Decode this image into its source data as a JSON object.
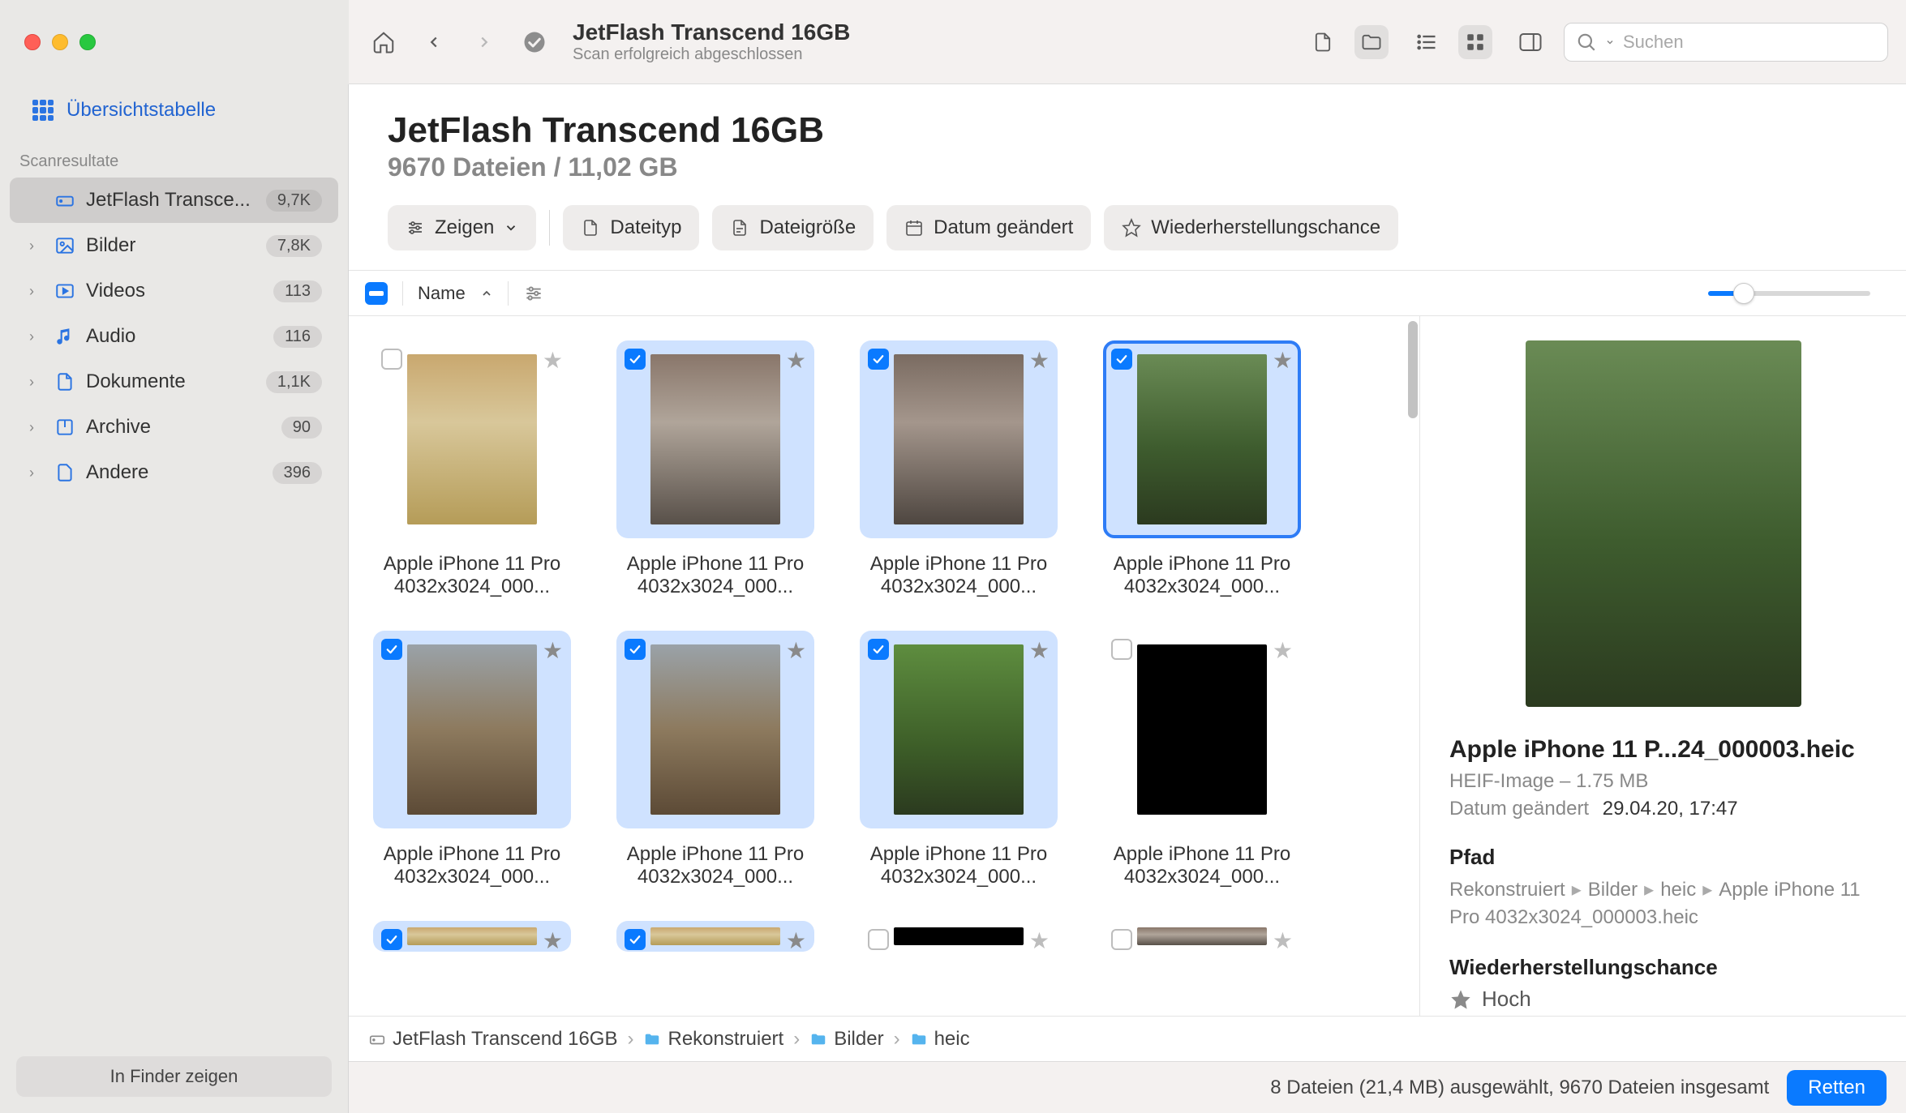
{
  "window": {
    "title": "JetFlash Transcend 16GB",
    "subtitle": "Scan erfolgreich abgeschlossen"
  },
  "search": {
    "placeholder": "Suchen"
  },
  "sidebar": {
    "overview_label": "Übersichtstabelle",
    "section_label": "Scanresultate",
    "items": [
      {
        "label": "JetFlash Transce...",
        "count": "9,7K",
        "icon": "drive",
        "selected": true,
        "expandable": false
      },
      {
        "label": "Bilder",
        "count": "7,8K",
        "icon": "image",
        "expandable": true
      },
      {
        "label": "Videos",
        "count": "113",
        "icon": "video",
        "expandable": true
      },
      {
        "label": "Audio",
        "count": "116",
        "icon": "audio",
        "expandable": true
      },
      {
        "label": "Dokumente",
        "count": "1,1K",
        "icon": "document",
        "expandable": true
      },
      {
        "label": "Archive",
        "count": "90",
        "icon": "archive",
        "expandable": true
      },
      {
        "label": "Andere",
        "count": "396",
        "icon": "other",
        "expandable": true
      }
    ],
    "footer_button": "In Finder zeigen"
  },
  "header": {
    "title": "JetFlash Transcend 16GB",
    "subtitle": "9670 Dateien / 11,02 GB"
  },
  "filters": {
    "show": "Zeigen",
    "filetype": "Dateityp",
    "filesize": "Dateigröße",
    "modified": "Datum geändert",
    "recovery": "Wiederherstellungschance"
  },
  "columns": {
    "name": "Name"
  },
  "tiles": [
    {
      "line1": "Apple iPhone 11 Pro",
      "line2": "4032x3024_000...",
      "checked": false,
      "selected": false,
      "thumb": "th-kitten"
    },
    {
      "line1": "Apple iPhone 11 Pro",
      "line2": "4032x3024_000...",
      "checked": true,
      "selected": true,
      "thumb": "th-cat1"
    },
    {
      "line1": "Apple iPhone 11 Pro",
      "line2": "4032x3024_000...",
      "checked": true,
      "selected": true,
      "thumb": "th-cat2"
    },
    {
      "line1": "Apple iPhone 11 Pro",
      "line2": "4032x3024_000...",
      "checked": true,
      "selected": true,
      "thumb": "th-chick",
      "outline": true
    },
    {
      "line1": "Apple iPhone 11 Pro",
      "line2": "4032x3024_000...",
      "checked": true,
      "selected": true,
      "thumb": "th-dog"
    },
    {
      "line1": "Apple iPhone 11 Pro",
      "line2": "4032x3024_000...",
      "checked": true,
      "selected": true,
      "thumb": "th-dog"
    },
    {
      "line1": "Apple iPhone 11 Pro",
      "line2": "4032x3024_000...",
      "checked": true,
      "selected": true,
      "thumb": "th-ducks"
    },
    {
      "line1": "Apple iPhone 11 Pro",
      "line2": "4032x3024_000...",
      "checked": false,
      "selected": false,
      "thumb": "th-black"
    },
    {
      "line1": "",
      "line2": "",
      "checked": true,
      "selected": true,
      "thumb": "th-kitten",
      "partial": true
    },
    {
      "line1": "",
      "line2": "",
      "checked": true,
      "selected": true,
      "thumb": "th-kitten",
      "partial": true
    },
    {
      "line1": "",
      "line2": "",
      "checked": false,
      "selected": false,
      "thumb": "th-black",
      "partial": true
    },
    {
      "line1": "",
      "line2": "",
      "checked": false,
      "selected": false,
      "thumb": "th-cat1",
      "partial": true
    }
  ],
  "inspector": {
    "filename": "Apple iPhone 11 P...24_000003.heic",
    "meta": "HEIF-Image – 1.75 MB",
    "date_label": "Datum geändert",
    "date_value": "29.04.20, 17:47",
    "path_heading": "Pfad",
    "path_segments": [
      "Rekonstruiert",
      "Bilder",
      "heic",
      "Apple iPhone 11 Pro 4032x3024_000003.heic"
    ],
    "recovery_heading": "Wiederherstellungschance",
    "recovery_value": "Hoch"
  },
  "breadcrumbs": [
    {
      "label": "JetFlash Transcend 16GB",
      "icon": "drive"
    },
    {
      "label": "Rekonstruiert",
      "icon": "folder"
    },
    {
      "label": "Bilder",
      "icon": "folder"
    },
    {
      "label": "heic",
      "icon": "folder"
    }
  ],
  "status": {
    "text": "8 Dateien (21,4 MB) ausgewählt, 9670 Dateien insgesamt",
    "recover_button": "Retten"
  }
}
